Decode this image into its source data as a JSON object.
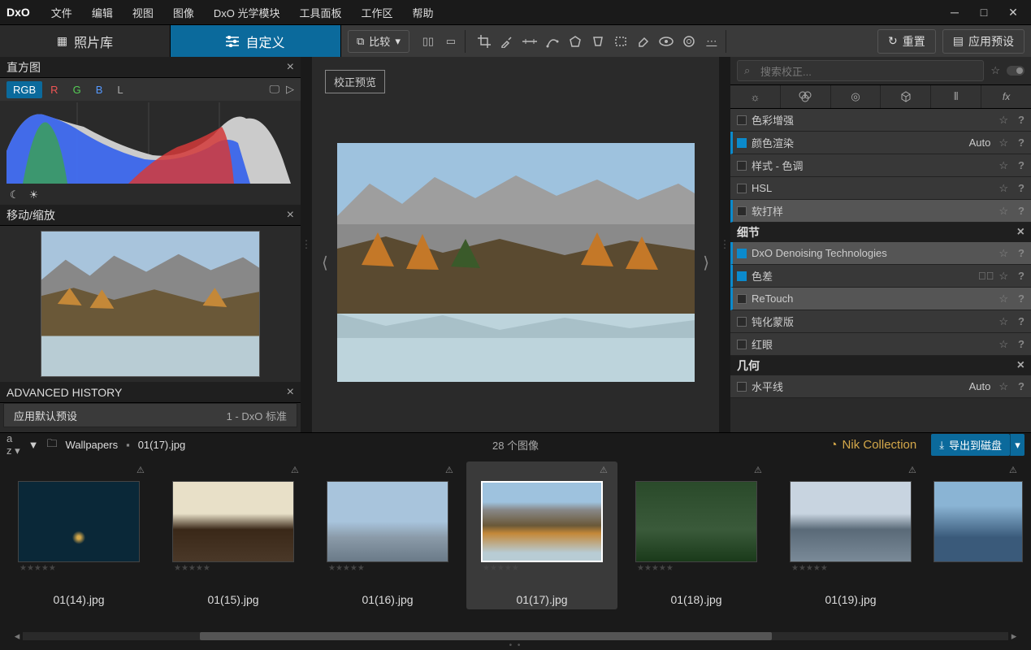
{
  "app": {
    "logo": "DxO"
  },
  "menu": [
    "文件",
    "编辑",
    "视图",
    "图像",
    "DxO 光学模块",
    "工具面板",
    "工作区",
    "帮助"
  ],
  "modes": {
    "library": "照片库",
    "custom": "自定义"
  },
  "toolbar": {
    "compare": "比较",
    "reset": "重置",
    "apply_preset": "应用预设"
  },
  "left": {
    "histogram_title": "直方图",
    "hist_tabs": {
      "rgb": "RGB",
      "r": "R",
      "g": "G",
      "b": "B",
      "l": "L"
    },
    "nav_title": "移动/缩放",
    "history_title": "ADVANCED HISTORY",
    "history_row": "应用默认预设",
    "history_index": "1 - DxO 标准"
  },
  "center": {
    "preview_label": "校正预览"
  },
  "right": {
    "search_placeholder": "搜索校正...",
    "sections": {
      "detail": "细节",
      "geometry": "几何"
    },
    "rows": {
      "color_accent": "色彩增强",
      "color_rendering": "颜色渲染",
      "style_toning": "样式 - 色调",
      "hsl": "HSL",
      "soft_proof": "软打样",
      "denoise": "DxO Denoising Technologies",
      "ca": "色差",
      "retouch": "ReTouch",
      "unsharp": "钝化蒙版",
      "redeye": "红眼",
      "horizon": "水平线"
    },
    "auto": "Auto"
  },
  "filmstrip": {
    "path_folder": "Wallpapers",
    "path_file": "01(17).jpg",
    "count": "28 个图像",
    "nik": "Nik Collection",
    "export": "导出到磁盘",
    "thumbs": [
      "01(14).jpg",
      "01(15).jpg",
      "01(16).jpg",
      "01(17).jpg",
      "01(18).jpg",
      "01(19).jpg"
    ]
  }
}
